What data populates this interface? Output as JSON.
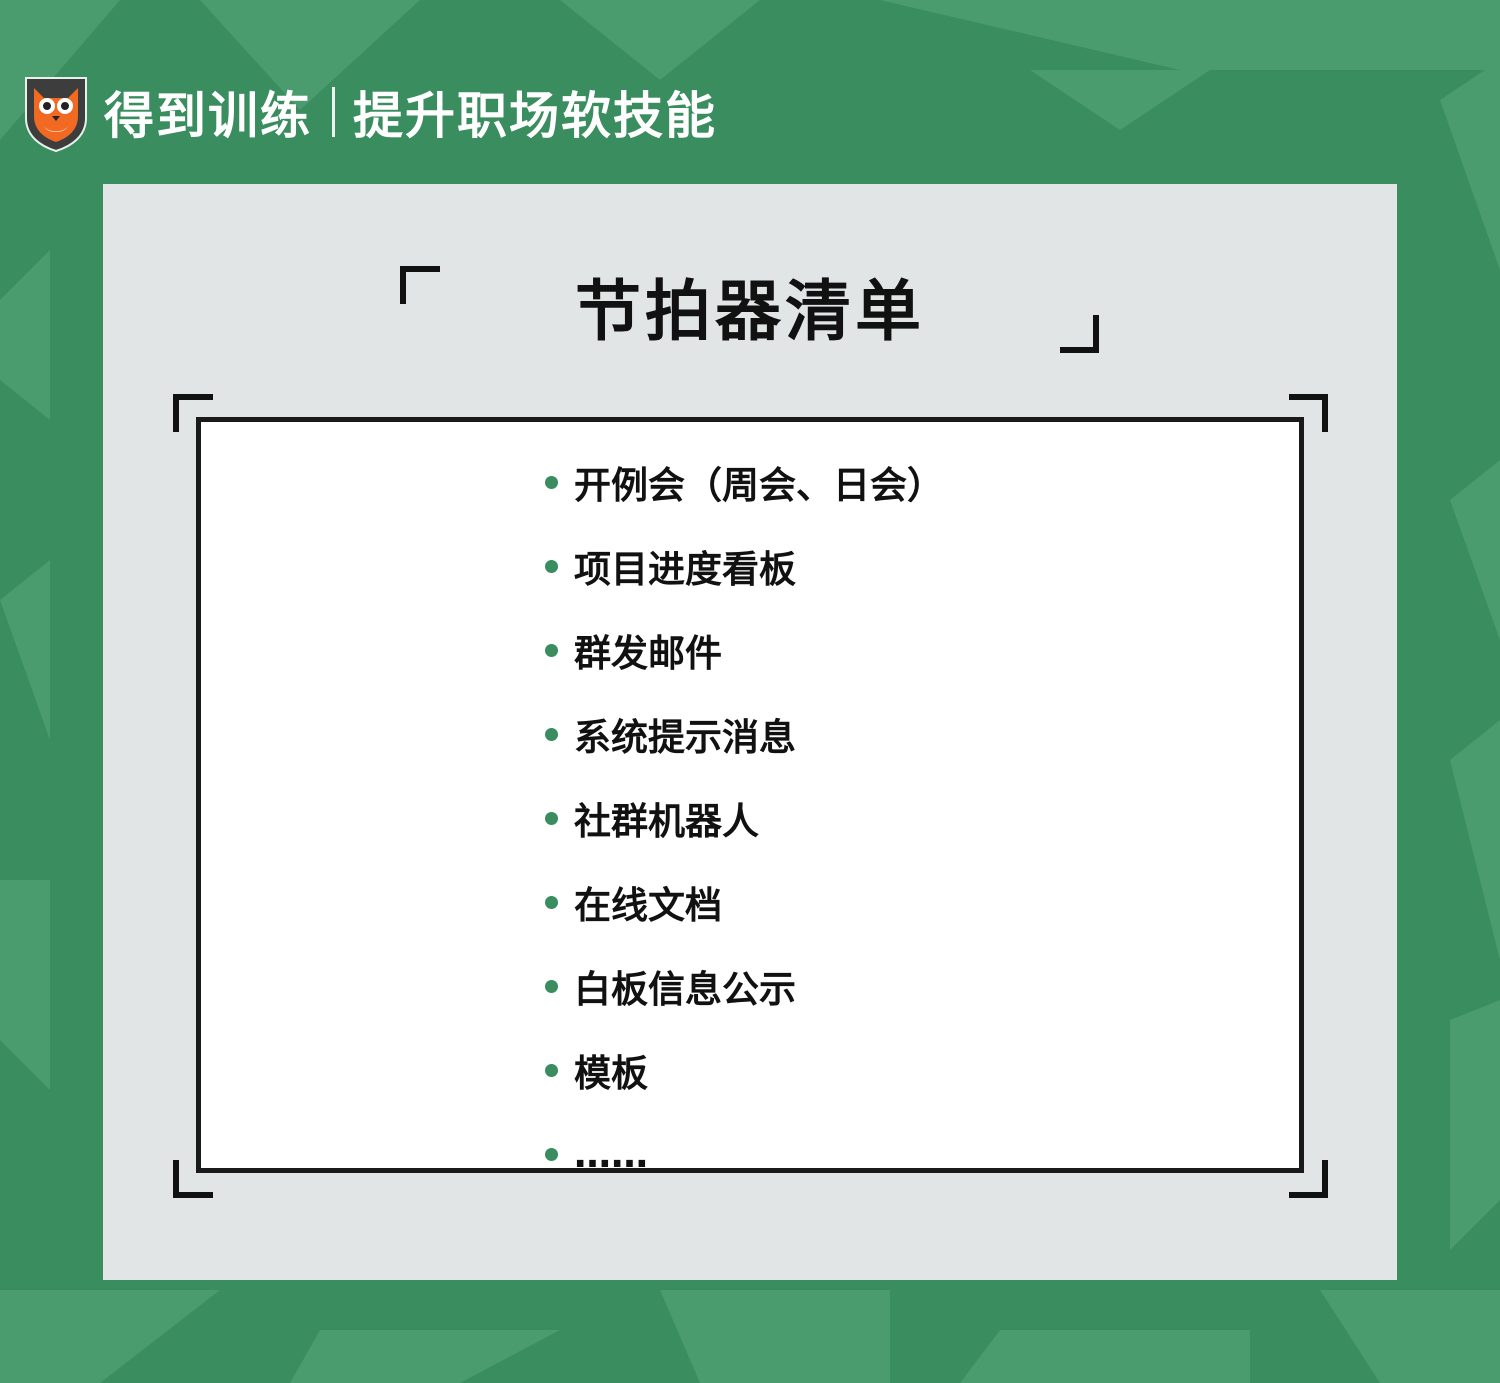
{
  "brand": {
    "name": "得到训练",
    "tagline": "提升职场软技能"
  },
  "title": "节拍器清单",
  "items": [
    "开例会（周会、日会）",
    "项目进度看板",
    "群发邮件",
    "系统提示消息",
    "社群机器人",
    "在线文档",
    "白板信息公示",
    "模板",
    "……"
  ],
  "colors": {
    "background": "#3a8d5e",
    "panel": "#e1e5e6",
    "card": "#ffffff",
    "accent": "#3a8d5e",
    "logo_orange": "#f26a22"
  }
}
